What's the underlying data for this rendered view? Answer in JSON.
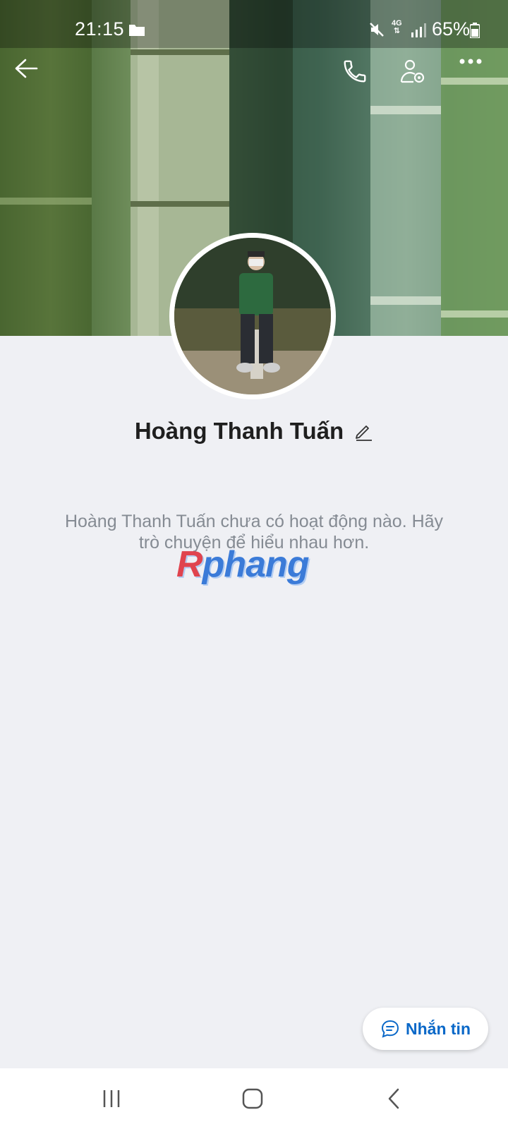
{
  "status_bar": {
    "time": "21:15",
    "network": "4G",
    "battery": "65%",
    "icons": [
      "folder-icon",
      "mute-icon",
      "signal-icon",
      "battery-icon"
    ]
  },
  "header": {
    "icons": [
      "back-arrow-icon",
      "phone-icon",
      "user-settings-icon",
      "more-icon"
    ]
  },
  "profile": {
    "name": "Hoàng Thanh Tuấn",
    "empty_message": "Hoàng Thanh Tuấn chưa có hoạt động nào. Hãy trò chuyện để hiểu nhau hơn."
  },
  "watermark": {
    "first_letter": "R",
    "rest": "phang"
  },
  "actions": {
    "message_label": "Nhắn tin",
    "accent_color": "#0a68c8"
  },
  "navigation": {
    "icons": [
      "recents-icon",
      "home-icon",
      "back-icon"
    ]
  }
}
